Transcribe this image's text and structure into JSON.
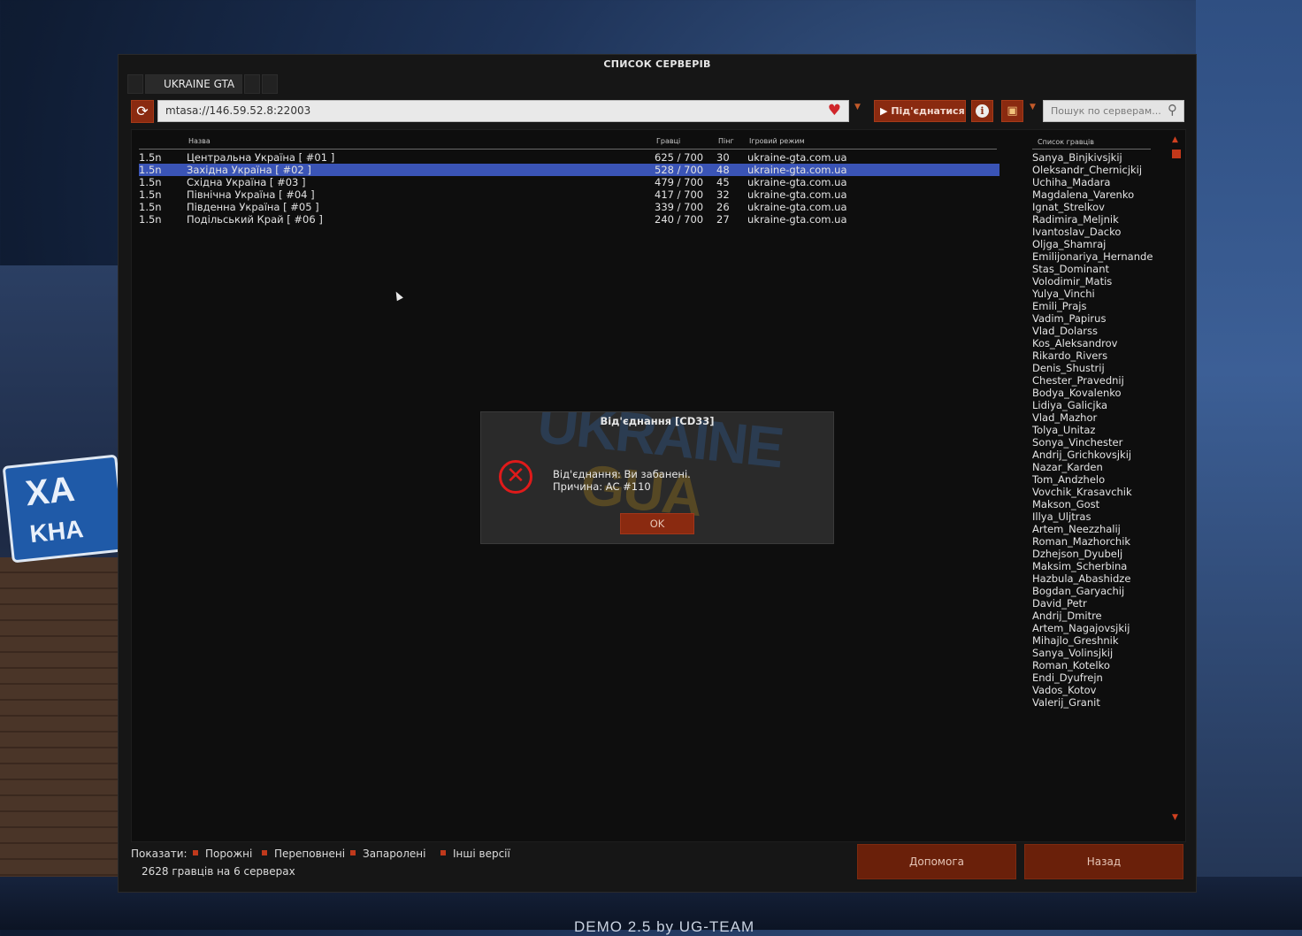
{
  "background": {
    "sign_text_1": "ХА",
    "sign_text_2": "KHA",
    "bottom_logo": "UKRAINE GUA",
    "demo_text": "DEMO 2.5 by UG-TEAM"
  },
  "window": {
    "title": "СПИСОК СЕРВЕРІВ",
    "tab_label": "UKRAINE GTA"
  },
  "toolbar": {
    "address_value": "mtasa://146.59.52.8:22003",
    "connect_label": "Під'єднатися",
    "search_placeholder": "Пошук по серверам..."
  },
  "server_list": {
    "columns": {
      "name": "Назва",
      "players": "Гравці",
      "ping": "Пінг",
      "gamemode": "Ігровий режим"
    },
    "rows": [
      {
        "version": "1.5n",
        "name": "Центральна Україна [ #01 ]",
        "players": "625 / 700",
        "ping": "30",
        "gamemode": "ukraine-gta.com.ua"
      },
      {
        "version": "1.5n",
        "name": "Західна Україна [ #02 ]",
        "players": "528 / 700",
        "ping": "48",
        "gamemode": "ukraine-gta.com.ua"
      },
      {
        "version": "1.5n",
        "name": "Східна Україна [ #03 ]",
        "players": "479 / 700",
        "ping": "45",
        "gamemode": "ukraine-gta.com.ua"
      },
      {
        "version": "1.5n",
        "name": "Північна Україна [ #04 ]",
        "players": "417 / 700",
        "ping": "32",
        "gamemode": "ukraine-gta.com.ua"
      },
      {
        "version": "1.5n",
        "name": "Південна Україна [ #05 ]",
        "players": "339 / 700",
        "ping": "26",
        "gamemode": "ukraine-gta.com.ua"
      },
      {
        "version": "1.5n",
        "name": "Подільський Край [ #06 ]",
        "players": "240 / 700",
        "ping": "27",
        "gamemode": "ukraine-gta.com.ua"
      }
    ]
  },
  "players_panel": {
    "header": "Список гравців",
    "players": [
      "Sanya_Binjkivsjkij",
      "Oleksandr_Chernicjkij",
      "Uchiha_Madara",
      "Magdalena_Varenko",
      "Ignat_Strelkov",
      "Radimira_Meljnik",
      "Ivantoslav_Dacko",
      "Oljga_Shamraj",
      "Emilijonariya_Hernande",
      "Stas_Dominant",
      "Volodimir_Matis",
      "Yulya_Vinchi",
      "Emili_Prajs",
      "Vadim_Papirus",
      "Vlad_Dolarss",
      "Kos_Aleksandrov",
      "Rikardo_Rivers",
      "Denis_Shustrij",
      "Chester_Pravednij",
      "Bodya_Kovalenko",
      "Lidiya_Galicjka",
      "Vlad_Mazhor",
      "Tolya_Unitaz",
      "Sonya_Vinchester",
      "Andrij_Grichkovsjkij",
      "Nazar_Karden",
      "Tom_Andzhelo",
      "Vovchik_Krasavchik",
      "Makson_Gost",
      "Illya_Uljtras",
      "Artem_Neezzhalij",
      "Roman_Mazhorchik",
      "Dzhejson_Dyubelj",
      "Maksim_Scherbina",
      "Hazbula_Abashidze",
      "Bogdan_Garyachij",
      "David_Petr",
      "Andrij_Dmitre",
      "Artem_Nagajovsjkij",
      "Mihajlo_Greshnik",
      "Sanya_Volinsjkij",
      "Roman_Kotelko",
      "Endi_Dyufrejn",
      "Vados_Kotov",
      "Valerij_Granit"
    ]
  },
  "footer": {
    "show_label": "Показати:",
    "filters": [
      "Порожні",
      "Переповнені",
      "Запаролені",
      "Інші версії"
    ],
    "count_text": "2628 гравців на 6 серверах",
    "help_label": "Допомога",
    "back_label": "Назад"
  },
  "dialog": {
    "title": "Від'єднання [CD33]",
    "message_line1": "Від'єднання: Ви забанені.",
    "message_line2": "Причина: AC #110",
    "ok_label": "OK",
    "watermark_1": "UKRAINE",
    "watermark_2": "GUA"
  },
  "colors": {
    "accent": "#8a2a10",
    "selected_row": "#3a54b6",
    "error_icon": "#e01a1a",
    "favorite_icon": "#d0262b"
  },
  "icons": {
    "refresh": "refresh-icon",
    "favorite": "heart-icon",
    "connect": "play-icon",
    "info": "info-icon",
    "host": "host-game-icon",
    "search": "search-icon",
    "error": "error-x-icon"
  }
}
